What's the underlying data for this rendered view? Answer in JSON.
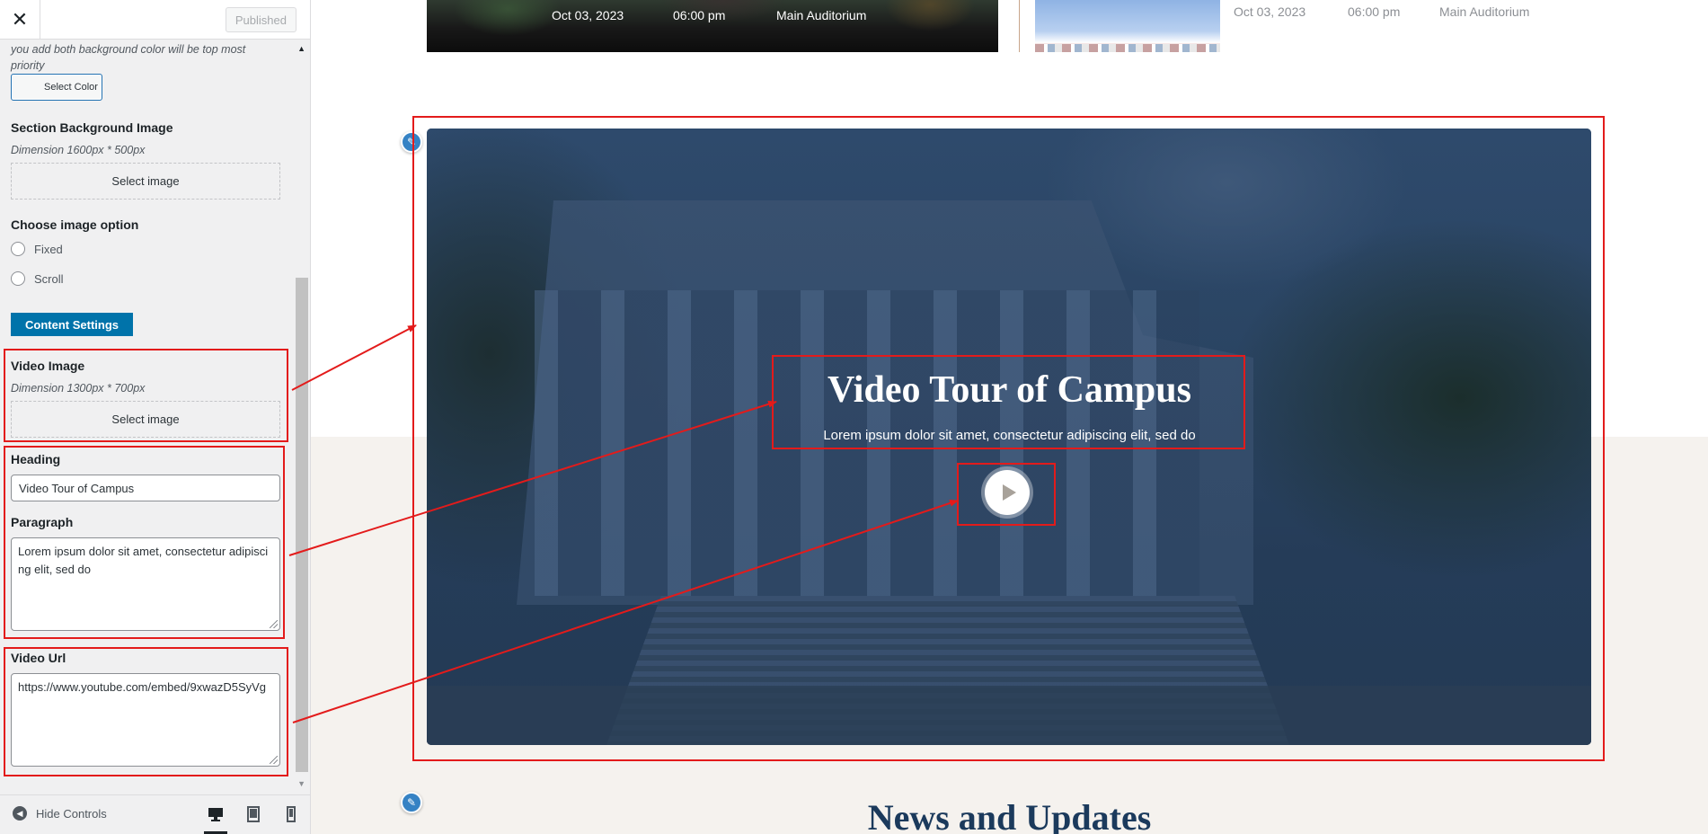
{
  "header": {
    "close_icon_glyph": "✕",
    "published_label": "Published"
  },
  "sidebar": {
    "note_text": "you add both background color will be top most priority",
    "select_color_label": "Select Color",
    "section_bg_image": {
      "label": "Section Background Image",
      "dimension": "Dimension 1600px * 500px",
      "button": "Select image"
    },
    "image_option": {
      "label": "Choose image option",
      "options": [
        "Fixed",
        "Scroll"
      ]
    },
    "content_settings_label": "Content Settings",
    "video_image": {
      "label": "Video Image",
      "dimension": "Dimension 1300px * 700px",
      "button": "Select image"
    },
    "heading": {
      "label": "Heading",
      "value": "Video Tour of Campus"
    },
    "paragraph": {
      "label": "Paragraph",
      "value": "Lorem ipsum dolor sit amet, consectetur adipiscing elit, sed do"
    },
    "video_url": {
      "label": "Video Url",
      "value": "https://www.youtube.com/embed/9xwazD5SyVg"
    }
  },
  "footer": {
    "hide_controls_label": "Hide Controls"
  },
  "preview": {
    "event1": {
      "date": "Oct 03, 2023",
      "time": "06:00 pm",
      "venue": "Main Auditorium"
    },
    "event2": {
      "date": "Oct 03, 2023",
      "time": "06:00 pm",
      "venue": "Main Auditorium"
    },
    "video_section": {
      "heading": "Video Tour of Campus",
      "paragraph": "Lorem ipsum dolor sit amet, consectetur adipiscing elit, sed do"
    },
    "news_heading": "News and Updates"
  },
  "colors": {
    "annotation_red": "#e31b1b",
    "accent_blue": "#0073aa",
    "video_overlay": "#243b57",
    "news_heading": "#1b3a5c"
  },
  "icons": [
    "close-icon",
    "scroll-up-icon",
    "scroll-down-icon",
    "hide-controls-icon",
    "desktop-icon",
    "tablet-icon",
    "mobile-icon",
    "pencil-icon",
    "play-icon"
  ]
}
